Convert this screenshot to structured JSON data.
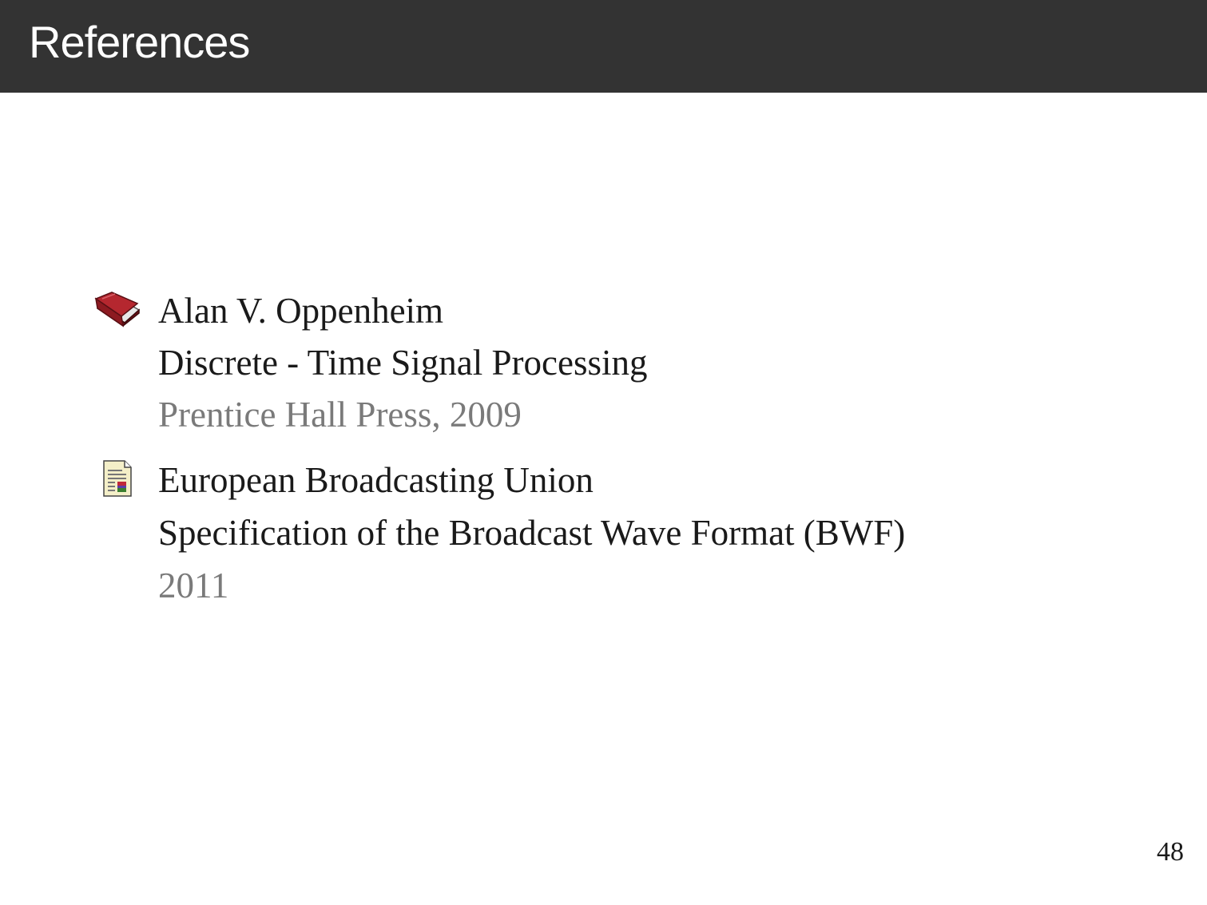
{
  "header": {
    "title": "References"
  },
  "references": [
    {
      "icon": "book-icon",
      "author": "Alan V. Oppenheim",
      "title": "Discrete - Time Signal Processing",
      "publication": "Prentice Hall Press, 2009"
    },
    {
      "icon": "article-icon",
      "author": "European Broadcasting Union",
      "title": "Specification of the Broadcast Wave Format (BWF)",
      "publication": "2011"
    }
  ],
  "footer": {
    "page_number": "48"
  },
  "colors": {
    "header_background": "#333333",
    "muted_text": "#7a7a7a",
    "book_cover": "#b5272f"
  }
}
